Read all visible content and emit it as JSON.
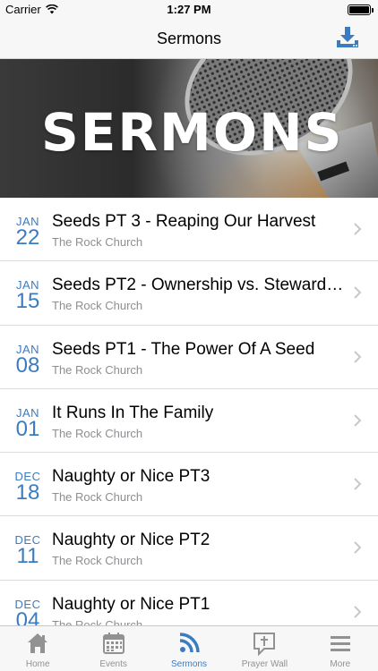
{
  "status_bar": {
    "carrier": "Carrier",
    "time": "1:27 PM"
  },
  "nav": {
    "title": "Sermons",
    "action_icon": "download-icon"
  },
  "hero": {
    "text": "SERMONS"
  },
  "colors": {
    "accent": "#3b7bbf",
    "inactive": "#929292",
    "subtitle": "#8e8e93"
  },
  "sermons": [
    {
      "month": "JAN",
      "day": "22",
      "title": "Seeds PT 3 - Reaping Our Harvest",
      "subtitle": "The Rock Church"
    },
    {
      "month": "JAN",
      "day": "15",
      "title": "Seeds PT2 - Ownership vs. Steward…",
      "subtitle": "The Rock Church"
    },
    {
      "month": "JAN",
      "day": "08",
      "title": "Seeds PT1 - The Power Of A Seed",
      "subtitle": "The Rock Church"
    },
    {
      "month": "JAN",
      "day": "01",
      "title": "It Runs In The Family",
      "subtitle": "The Rock Church"
    },
    {
      "month": "DEC",
      "day": "18",
      "title": "Naughty or Nice PT3",
      "subtitle": "The Rock Church"
    },
    {
      "month": "DEC",
      "day": "11",
      "title": "Naughty or Nice PT2",
      "subtitle": "The Rock Church"
    },
    {
      "month": "DEC",
      "day": "04",
      "title": "Naughty or Nice PT1",
      "subtitle": "The Rock Church"
    }
  ],
  "tabs": [
    {
      "label": "Home",
      "icon": "home-icon",
      "active": false
    },
    {
      "label": "Events",
      "icon": "calendar-icon",
      "active": false
    },
    {
      "label": "Sermons",
      "icon": "rss-icon",
      "active": true
    },
    {
      "label": "Prayer Wall",
      "icon": "prayer-icon",
      "active": false
    },
    {
      "label": "More",
      "icon": "menu-icon",
      "active": false
    }
  ]
}
